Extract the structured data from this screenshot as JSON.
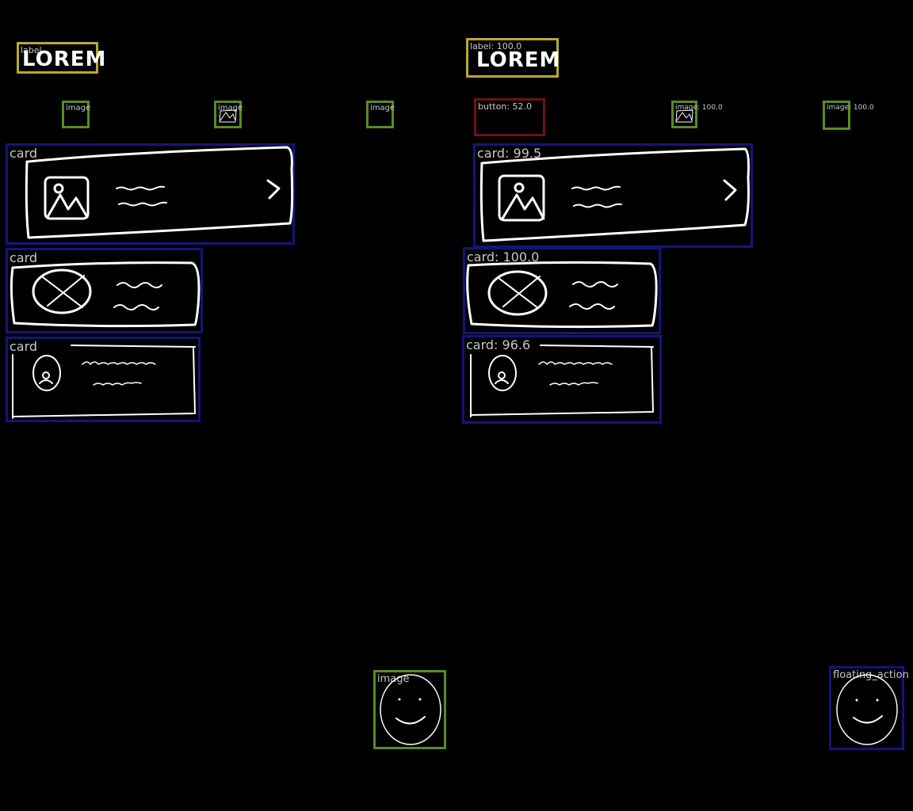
{
  "left": {
    "label": {
      "tag": "label",
      "text": "LOREM"
    },
    "images": [
      {
        "tag": "image"
      },
      {
        "tag": "image"
      },
      {
        "tag": "image"
      }
    ],
    "cards": [
      {
        "tag": "card"
      },
      {
        "tag": "card"
      },
      {
        "tag": "card"
      }
    ],
    "bottom_image": {
      "tag": "image"
    }
  },
  "right": {
    "label": {
      "tag": "label: 100.0",
      "text": "LOREM"
    },
    "button": {
      "tag": "button: 52.0"
    },
    "images": [
      {
        "tag": "image: 100.0"
      },
      {
        "tag": "image: 100.0"
      }
    ],
    "cards": [
      {
        "tag": "card: 99.5"
      },
      {
        "tag": "card: 100.0"
      },
      {
        "tag": "card: 96.6"
      }
    ],
    "fab": {
      "tag": "floating_action"
    }
  },
  "colors": {
    "background": "#000000",
    "label_box": "#b9a92a",
    "image_box": "#5a8a22",
    "card_box": "#14147a",
    "button_box": "#6a1416",
    "fab_box": "#14147a"
  }
}
